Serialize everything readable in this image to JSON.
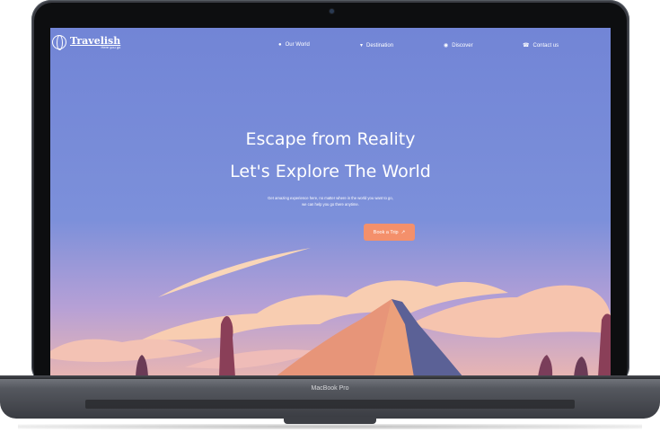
{
  "device": {
    "label": "MacBook Pro"
  },
  "brand": {
    "name": "Travelish",
    "tagline": "Here you go",
    "icon": "globe-icon"
  },
  "nav": {
    "items": [
      {
        "label": "Our World",
        "icon": "globe-icon"
      },
      {
        "label": "Destination",
        "icon": "map-pin-icon"
      },
      {
        "label": "Discover",
        "icon": "compass-icon"
      },
      {
        "label": "Contact us",
        "icon": "phone-icon"
      }
    ]
  },
  "hero": {
    "title_line1": "Escape from Reality",
    "title_line2": "Let's Explore The World",
    "sub_line1": "Get amazing experience here, no matter where in the world you want to go,",
    "sub_line2": "we can help you go there anytime.",
    "cta_label": "Book a Trip",
    "cta_icon": "arrow-up-right-icon"
  },
  "colors": {
    "sky_top": "#7285d6",
    "cta": "#f4906b",
    "mountain_light": "#e9a07e",
    "mountain_dark": "#5b6196",
    "cloud": "#f8d2b4"
  }
}
